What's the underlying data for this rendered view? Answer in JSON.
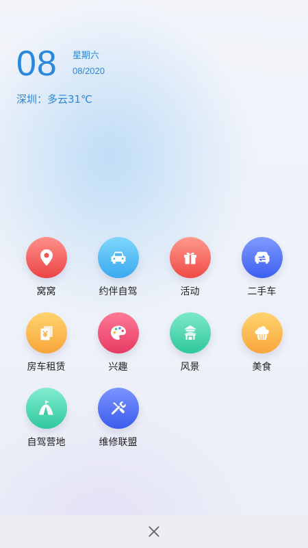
{
  "date": {
    "day": "08",
    "weekday": "星期六",
    "month_year": "08/2020"
  },
  "weather": {
    "text": "深圳：多云31℃"
  },
  "colors": {
    "accent": "#2a87de"
  },
  "menu": [
    {
      "label": "窝窝",
      "icon": "location-pin-icon",
      "gradient": [
        "#ff8f8a",
        "#ea4545"
      ]
    },
    {
      "label": "约伴自驾",
      "icon": "car-icon",
      "gradient": [
        "#7fd6fb",
        "#39a9ef"
      ]
    },
    {
      "label": "活动",
      "icon": "gift-icon",
      "gradient": [
        "#ff9a8c",
        "#f04a45"
      ]
    },
    {
      "label": "二手车",
      "icon": "exchange-car-icon",
      "gradient": [
        "#7f9bff",
        "#3d5ff0"
      ]
    },
    {
      "label": "房车租赁",
      "icon": "rental-yen-icon",
      "gradient": [
        "#ffd36e",
        "#f8a53a"
      ]
    },
    {
      "label": "兴趣",
      "icon": "palette-icon",
      "gradient": [
        "#ff7a96",
        "#e53a62"
      ]
    },
    {
      "label": "风景",
      "icon": "pavilion-icon",
      "gradient": [
        "#7ee9c9",
        "#2fc79b"
      ]
    },
    {
      "label": "美食",
      "icon": "cupcake-icon",
      "gradient": [
        "#ffd46f",
        "#f8a63c"
      ]
    },
    {
      "label": "自驾营地",
      "icon": "tent-icon",
      "gradient": [
        "#82eccf",
        "#2fc89e"
      ]
    },
    {
      "label": "维修联盟",
      "icon": "repair-tools-icon",
      "gradient": [
        "#7b95ff",
        "#3b5ced"
      ]
    }
  ],
  "close": {
    "icon": "close-icon"
  }
}
